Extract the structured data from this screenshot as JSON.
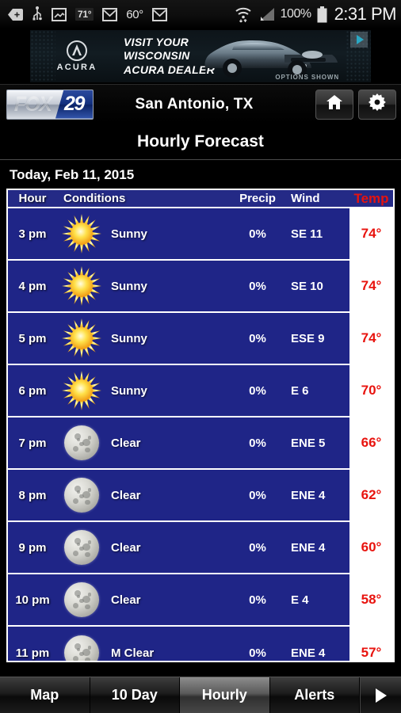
{
  "statusbar": {
    "icons_left": [
      "back-arrow-icon",
      "usb-icon",
      "photo-icon",
      "weather-temp-badge",
      "gmail-icon",
      "second-temp",
      "gmail-icon-2"
    ],
    "temp_badge": "71°",
    "temp_second": "60°",
    "wifi_icon": "wifi-icon",
    "signal_icon": "cell-signal-icon",
    "battery_percent": "100%",
    "battery_icon": "battery-full-icon",
    "time": "2:31 PM"
  },
  "ad": {
    "brand": "ACURA",
    "line1": "VISIT YOUR",
    "line2": "WISCONSIN",
    "line3": "ACURA DEALER",
    "disclaimer": "OPTIONS SHOWN",
    "adchoices_label": "AdChoices"
  },
  "header": {
    "logo_word": "FOX",
    "logo_number": "29",
    "city": "San Antonio, TX",
    "home_icon": "home-icon",
    "settings_icon": "gear-icon"
  },
  "page": {
    "title": "Hourly Forecast",
    "date": "Today, Feb 11, 2015"
  },
  "table": {
    "columns": [
      "Hour",
      "Conditions",
      "Precip",
      "Wind",
      "Temp"
    ],
    "rows": [
      {
        "hour": "3 pm",
        "icon": "sun-icon",
        "conditions": "Sunny",
        "precip": "0%",
        "wind": "SE 11",
        "temp": "74°"
      },
      {
        "hour": "4 pm",
        "icon": "sun-icon",
        "conditions": "Sunny",
        "precip": "0%",
        "wind": "SE 10",
        "temp": "74°"
      },
      {
        "hour": "5 pm",
        "icon": "sun-icon",
        "conditions": "Sunny",
        "precip": "0%",
        "wind": "ESE 9",
        "temp": "74°"
      },
      {
        "hour": "6 pm",
        "icon": "sun-icon",
        "conditions": "Sunny",
        "precip": "0%",
        "wind": "E 6",
        "temp": "70°"
      },
      {
        "hour": "7 pm",
        "icon": "moon-icon",
        "conditions": "Clear",
        "precip": "0%",
        "wind": "ENE 5",
        "temp": "66°"
      },
      {
        "hour": "8 pm",
        "icon": "moon-icon",
        "conditions": "Clear",
        "precip": "0%",
        "wind": "ENE 4",
        "temp": "62°"
      },
      {
        "hour": "9 pm",
        "icon": "moon-icon",
        "conditions": "Clear",
        "precip": "0%",
        "wind": "ENE 4",
        "temp": "60°"
      },
      {
        "hour": "10 pm",
        "icon": "moon-icon",
        "conditions": "Clear",
        "precip": "0%",
        "wind": "E 4",
        "temp": "58°"
      },
      {
        "hour": "11 pm",
        "icon": "moon-icon",
        "conditions": "M Clear",
        "precip": "0%",
        "wind": "ENE 4",
        "temp": "57°"
      }
    ]
  },
  "tabs": [
    {
      "label": "Map",
      "active": false
    },
    {
      "label": "10 Day",
      "active": false
    },
    {
      "label": "Hourly",
      "active": true
    },
    {
      "label": "Alerts",
      "active": false
    }
  ],
  "tab_more_icon": "play-arrow-icon",
  "colors": {
    "table_blue": "#1f2587",
    "temp_red": "#e8130e",
    "fox_blue": "#12307f"
  }
}
